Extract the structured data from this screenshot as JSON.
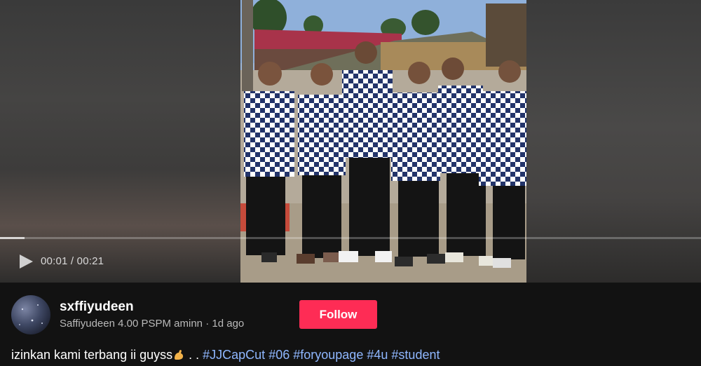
{
  "player": {
    "time_current": "00:01",
    "time_separator": " / ",
    "time_total": "00:21",
    "progress_fraction": 0.035
  },
  "author": {
    "username": "sxffiyudeen",
    "display_name": "Saffiyudeen 4.00 PSPM aminn",
    "separator": " · ",
    "posted": "1d ago"
  },
  "follow_label": "Follow",
  "caption": {
    "text": "izinkan kami terbang ii guyss",
    "emoji_icon": "flexed-biceps-icon",
    "dots": " . . ",
    "hashtags": [
      "#JJCapCut",
      "#06",
      "#foryoupage",
      "#4u",
      "#student"
    ]
  },
  "colors": {
    "follow": "#fe2c55",
    "hashtag": "#8fb7ff",
    "background": "#121212"
  }
}
